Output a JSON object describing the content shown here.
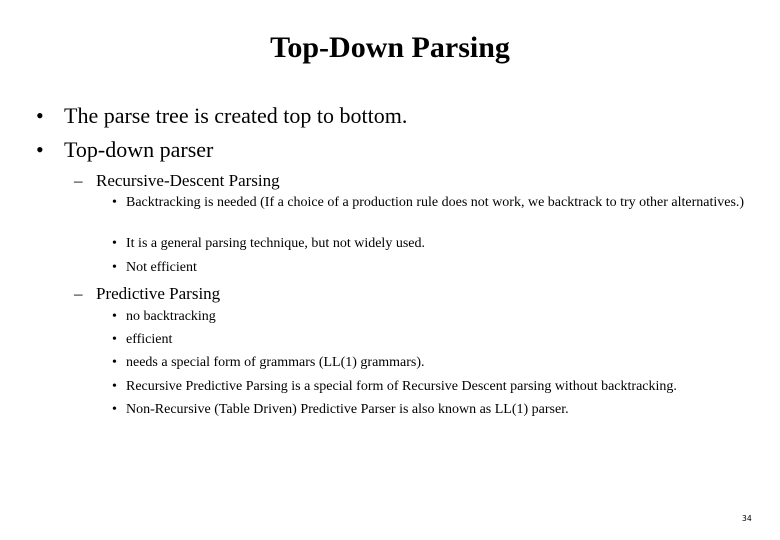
{
  "slide": {
    "title": "Top-Down Parsing",
    "bullet_symbol": "•",
    "dash_symbol": "–",
    "items": [
      "The parse tree is created top to bottom.",
      "Top-down parser"
    ],
    "sections": [
      {
        "heading": "Recursive-Descent Parsing",
        "points": [
          "Backtracking is needed (If a choice of a production rule does not work, we backtrack to try other alternatives.)",
          "It is a general parsing technique, but not widely used.",
          "Not efficient"
        ]
      },
      {
        "heading": "Predictive Parsing",
        "points": [
          "no backtracking",
          "efficient",
          "needs a special form of grammars (LL(1) grammars).",
          "Recursive Predictive Parsing  is a special form of Recursive Descent parsing without backtracking.",
          "Non-Recursive (Table Driven) Predictive Parser is also known as LL(1) parser."
        ]
      }
    ],
    "page_number": "34"
  }
}
